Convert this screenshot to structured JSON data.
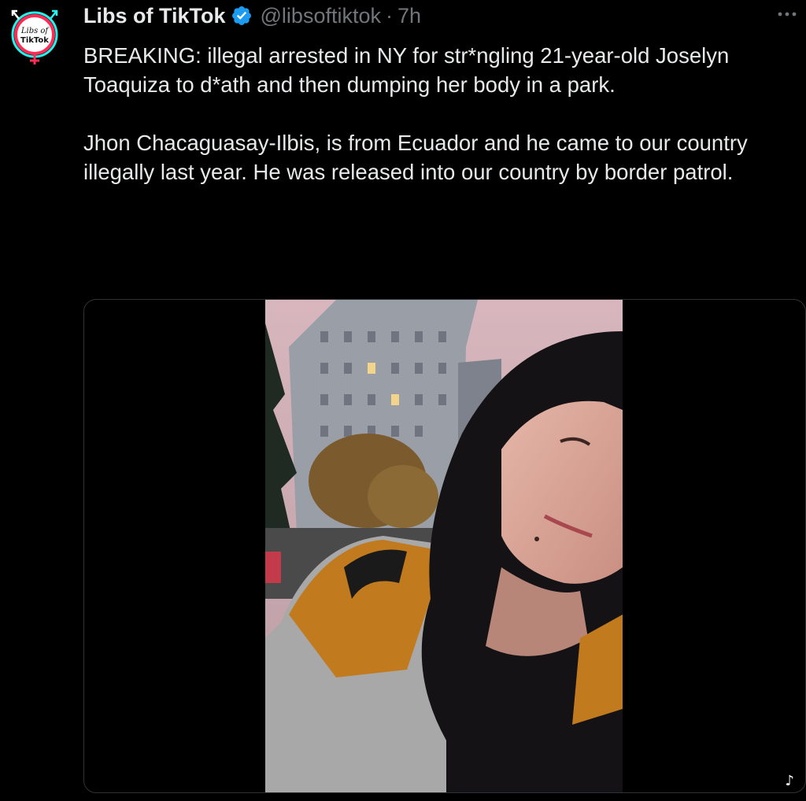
{
  "tweet": {
    "author_name": "Libs of TikTok",
    "handle": "@libsoftiktok",
    "separator": "·",
    "time": "7h",
    "paragraphs": [
      "BREAKING: illegal arrested in NY for str*ngling 21-year-old Joselyn Toaquiza to d*ath and then dumping her body in a park.",
      "Jhon Chacaguasay-Ilbis, is from Ecuador and he came to our country illegally last year. He was released into our country by border patrol."
    ]
  },
  "avatar": {
    "logo_text_line1": "Libs of",
    "logo_text_line2": "TikTok"
  },
  "icons": {
    "verified": "verified-badge-icon",
    "more": "more-horizontal-icon"
  },
  "colors": {
    "background": "#000000",
    "text": "#e7e9ea",
    "muted": "#71767b",
    "verified": "#1d9bf0",
    "logo_pink": "#fe2c55",
    "logo_cyan": "#25f4ee"
  }
}
